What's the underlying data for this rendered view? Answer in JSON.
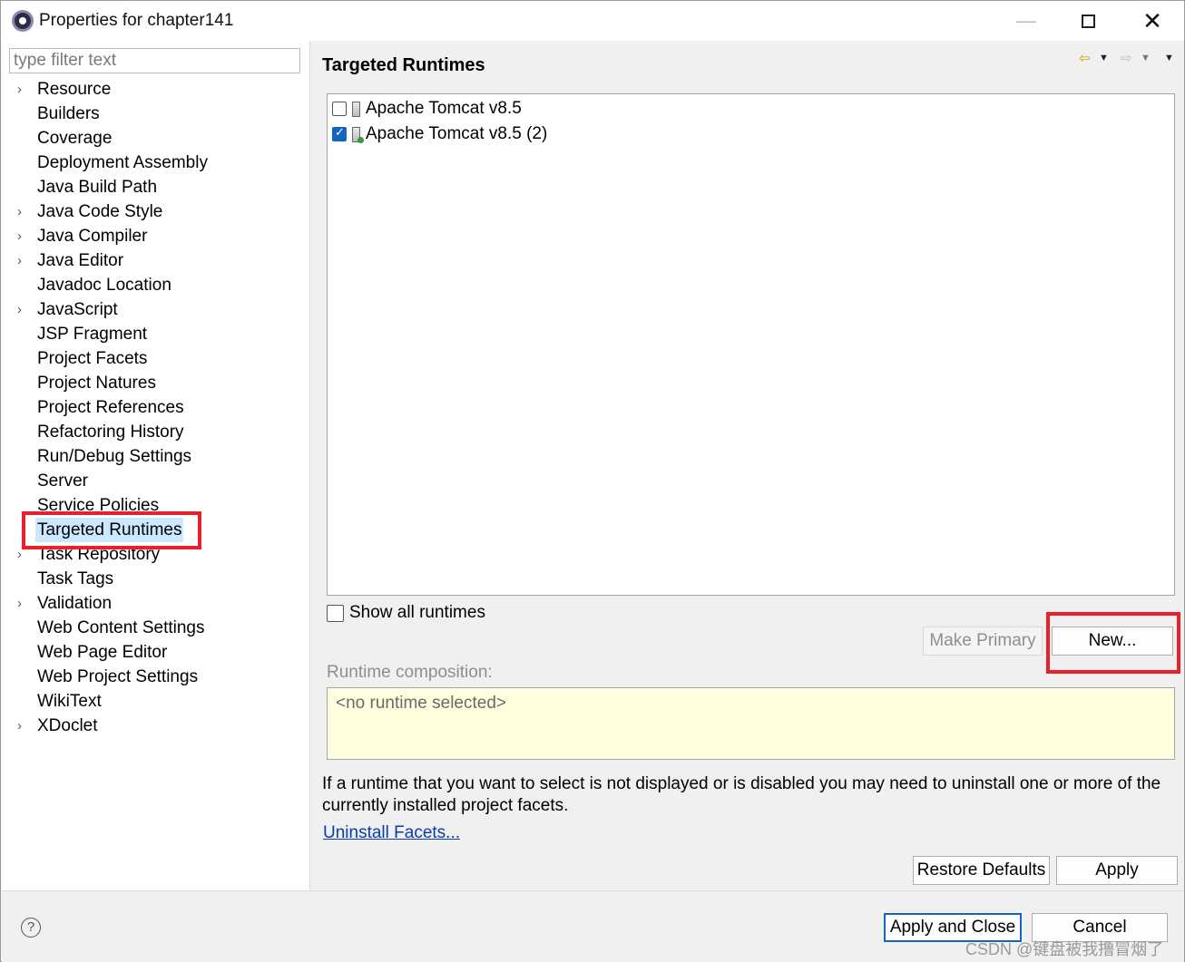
{
  "window": {
    "title": "Properties for chapter141",
    "minimize": "—",
    "close": "✕"
  },
  "sidebar": {
    "filter_placeholder": "type filter text",
    "items": [
      {
        "label": "Resource",
        "expandable": true
      },
      {
        "label": "Builders",
        "expandable": false
      },
      {
        "label": "Coverage",
        "expandable": false
      },
      {
        "label": "Deployment Assembly",
        "expandable": false
      },
      {
        "label": "Java Build Path",
        "expandable": false
      },
      {
        "label": "Java Code Style",
        "expandable": true
      },
      {
        "label": "Java Compiler",
        "expandable": true
      },
      {
        "label": "Java Editor",
        "expandable": true
      },
      {
        "label": "Javadoc Location",
        "expandable": false
      },
      {
        "label": "JavaScript",
        "expandable": true
      },
      {
        "label": "JSP Fragment",
        "expandable": false
      },
      {
        "label": "Project Facets",
        "expandable": false
      },
      {
        "label": "Project Natures",
        "expandable": false
      },
      {
        "label": "Project References",
        "expandable": false
      },
      {
        "label": "Refactoring History",
        "expandable": false
      },
      {
        "label": "Run/Debug Settings",
        "expandable": false
      },
      {
        "label": "Server",
        "expandable": false
      },
      {
        "label": "Service Policies",
        "expandable": false
      },
      {
        "label": "Targeted Runtimes",
        "expandable": false,
        "selected": true
      },
      {
        "label": "Task Repository",
        "expandable": true
      },
      {
        "label": "Task Tags",
        "expandable": false
      },
      {
        "label": "Validation",
        "expandable": true
      },
      {
        "label": "Web Content Settings",
        "expandable": false
      },
      {
        "label": "Web Page Editor",
        "expandable": false
      },
      {
        "label": "Web Project Settings",
        "expandable": false
      },
      {
        "label": "WikiText",
        "expandable": false
      },
      {
        "label": "XDoclet",
        "expandable": true
      }
    ]
  },
  "main": {
    "title": "Targeted Runtimes",
    "runtimes": [
      {
        "label": "Apache Tomcat v8.5",
        "checked": false
      },
      {
        "label": "Apache Tomcat v8.5 (2)",
        "checked": true
      }
    ],
    "show_all_label": "Show all runtimes",
    "make_primary_label": "Make Primary",
    "new_label": "New...",
    "composition_label": "Runtime composition:",
    "composition_value": "<no runtime selected>",
    "info_text": "If a runtime that you want to select is not displayed or is disabled you may need to uninstall one or more of the currently installed project facets.",
    "uninstall_link": "Uninstall Facets...",
    "restore_defaults_label": "Restore Defaults",
    "apply_label": "Apply"
  },
  "footer": {
    "help_label": "?",
    "apply_close_label": "Apply and Close",
    "cancel_label": "Cancel",
    "watermark": "CSDN @键盘被我撸冒烟了"
  },
  "colors": {
    "highlight": "#e8202a",
    "selection": "#cce8ff",
    "accent": "#1565c0",
    "composition_bg": "#ffffe0"
  }
}
